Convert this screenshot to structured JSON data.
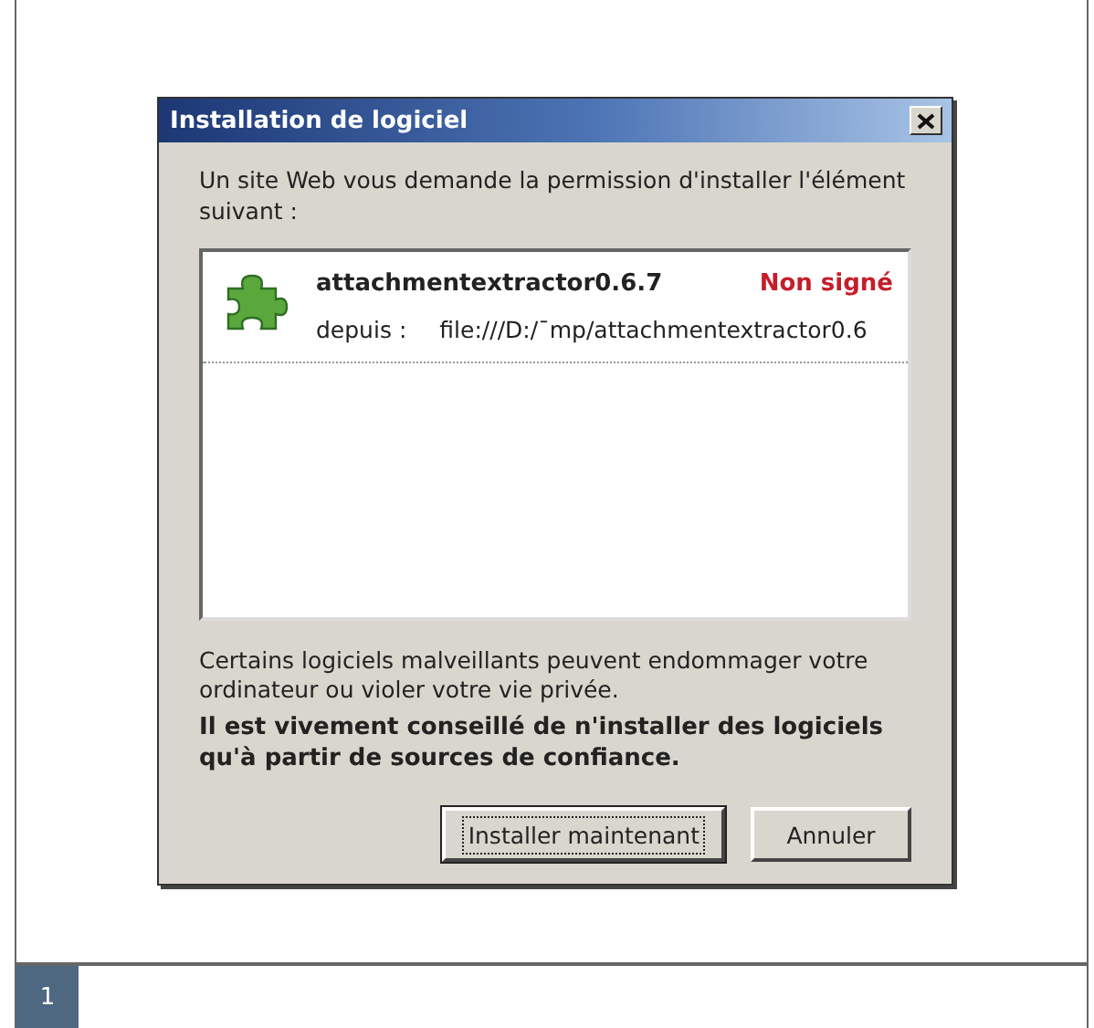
{
  "window": {
    "title": "Installation de logiciel"
  },
  "prompt": "Un site Web vous demande la permission d'installer l'élément suivant :",
  "items": [
    {
      "name": "attachmentextractor0.6.7",
      "status": "Non signé",
      "source_label": "depuis :",
      "source": "file:///D:/¯mp/attachmentextractor0.6"
    }
  ],
  "warning": "Certains logiciels malveillants peuvent endommager votre ordinateur ou violer votre vie privée.",
  "advice": "Il est vivement conseillé de n'installer des logiciels qu'à partir de sources de confiance.",
  "buttons": [
    {
      "label": "Installer maintenant",
      "selected": true
    },
    {
      "label": "Annuler",
      "selected": false
    }
  ],
  "figure_number": "1"
}
